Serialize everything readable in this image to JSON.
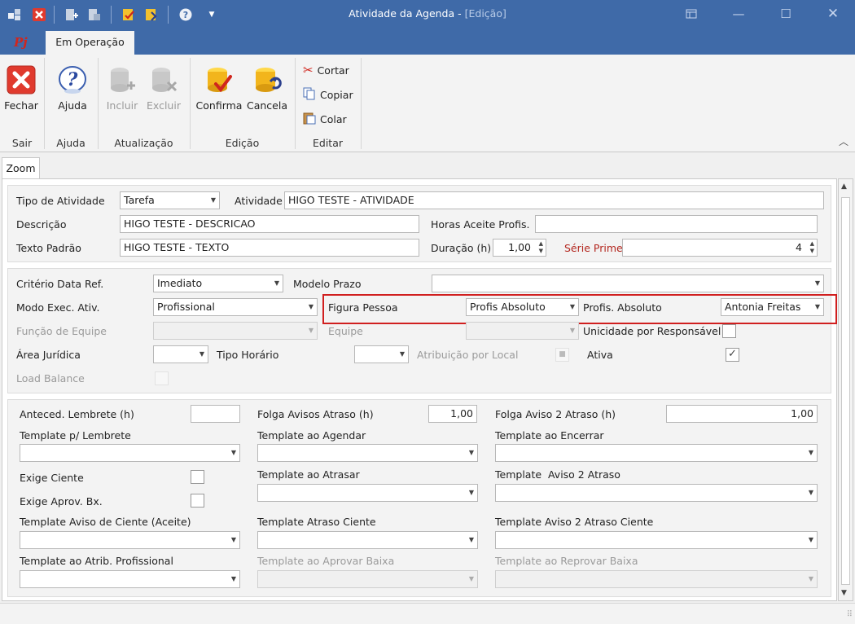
{
  "window": {
    "title": "Atividade da Agenda -",
    "mode": "[Edição]"
  },
  "ribbon": {
    "tab_app": "Pj",
    "tab_active": "Em Operação",
    "buttons": {
      "fechar": "Fechar",
      "ajuda": "Ajuda",
      "incluir": "Incluir",
      "excluir": "Excluir",
      "confirma": "Confirma",
      "cancela": "Cancela",
      "cortar": "Cortar",
      "copiar": "Copiar",
      "colar": "Colar"
    },
    "groups": {
      "sair": "Sair",
      "ajuda": "Ajuda",
      "atualizacao": "Atualização",
      "edicao": "Edição",
      "editar": "Editar"
    }
  },
  "tabs": {
    "zoom": "Zoom"
  },
  "section1": {
    "tipo_atividade_label": "Tipo de Atividade",
    "tipo_atividade_value": "Tarefa",
    "atividade_label": "Atividade",
    "atividade_value": "HIGO TESTE - ATIVIDADE",
    "descricao_label": "Descrição",
    "descricao_value": "HIGO TESTE - DESCRICAO",
    "horas_aceite_label": "Horas Aceite Profis.",
    "horas_aceite_value": "",
    "texto_padrao_label": "Texto Padrão",
    "texto_padrao_value": "HIGO TESTE - TEXTO",
    "duracao_label": "Duração (h)",
    "duracao_value": "1,00",
    "serie_prime_label": "Série Prime",
    "serie_prime_value": "4"
  },
  "section2": {
    "criterio_label": "Critério Data Ref.",
    "criterio_value": "Imediato",
    "modelo_prazo_label": "Modelo Prazo",
    "modelo_prazo_value": "",
    "modo_exec_label": "Modo Exec. Ativ.",
    "modo_exec_value": "Profissional",
    "figura_pessoa_label": "Figura Pessoa",
    "figura_pessoa_value": "Profis Absoluto",
    "profis_absoluto_label": "Profis. Absoluto",
    "profis_absoluto_value": "Antonia Freitas",
    "funcao_equipe_label": "Função de Equipe",
    "equipe_label": "Equipe",
    "unicidade_label": "Unicidade por Responsável",
    "area_juridica_label": "Área Jurídica",
    "tipo_horario_label": "Tipo Horário",
    "atribuicao_local_label": "Atribuição por Local",
    "ativa_label": "Ativa",
    "load_balance_label": "Load Balance",
    "ativa_checked": "✓"
  },
  "section3": {
    "anteced_label": "Anteced. Lembrete (h)",
    "anteced_value": "",
    "folga_avisos_label": "Folga Avisos Atraso (h)",
    "folga_avisos_value": "1,00",
    "folga_aviso2_label": "Folga Aviso 2 Atraso (h)",
    "folga_aviso2_value": "1,00",
    "tpl_lembrete_label": "Template p/ Lembrete",
    "tpl_agendar_label": "Template ao Agendar",
    "tpl_encerrar_label": "Template ao Encerrar",
    "exige_ciente_label": "Exige Ciente",
    "tpl_atrasar_label": "Template ao Atrasar",
    "tpl_aviso2_label": "Template  Aviso 2 Atraso",
    "exige_aprov_label": "Exige Aprov. Bx.",
    "tpl_aviso_ciente_label": "Template Aviso de Ciente (Aceite)",
    "tpl_atraso_ciente_label": "Template Atraso Ciente",
    "tpl_aviso2_ciente_label": "Template Aviso 2 Atraso Ciente",
    "tpl_atrib_prof_label": "Template ao Atrib. Profissional",
    "tpl_aprovar_label": "Template ao Aprovar Baixa",
    "tpl_reprovar_label": "Template ao Reprovar Baixa"
  },
  "colors": {
    "titlebar": "#3f6aa8",
    "highlight": "#d01f1f",
    "serie_prime": "#b3261e"
  }
}
